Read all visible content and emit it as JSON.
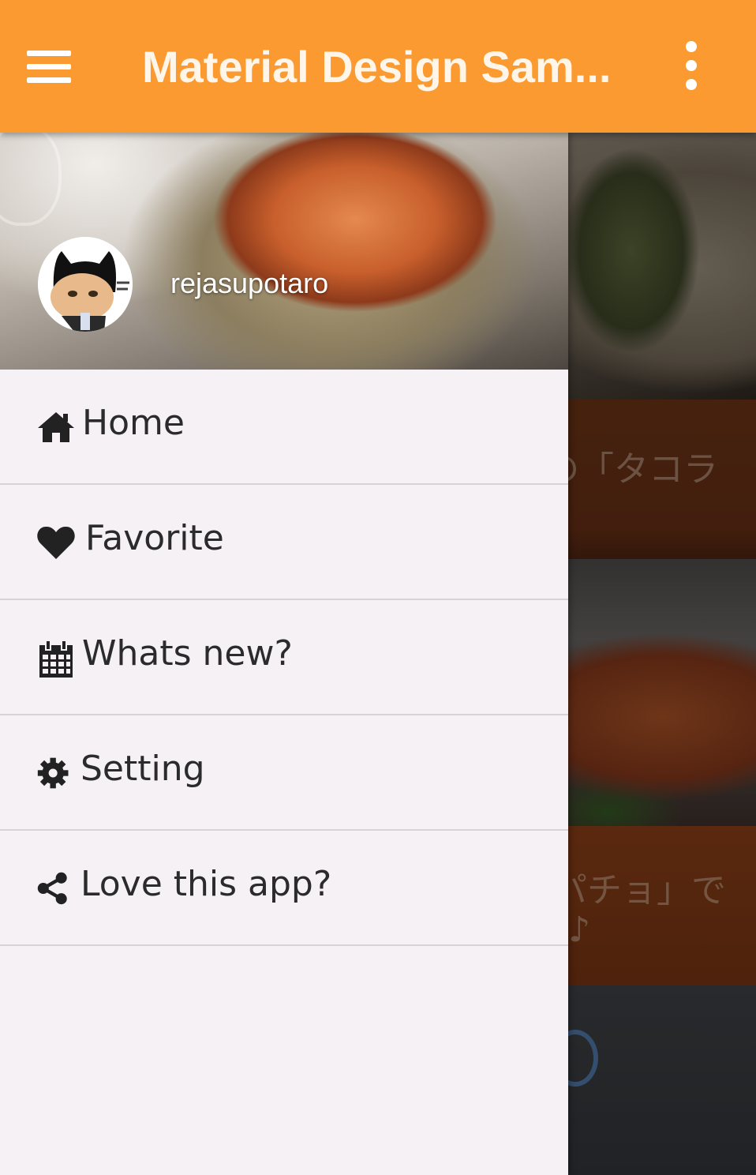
{
  "toolbar": {
    "title": "Material Design Sam...",
    "background_color": "#fb9a30",
    "menu_icon": "hamburger-menu-icon",
    "overflow_icon": "more-vertical-icon"
  },
  "drawer": {
    "header": {
      "username": "rejasupotaro"
    },
    "items": [
      {
        "label": "Home",
        "icon": "home-icon"
      },
      {
        "label": "Favorite",
        "icon": "heart-icon"
      },
      {
        "label": "Whats new?",
        "icon": "calendar-icon"
      },
      {
        "label": "Setting",
        "icon": "gear-icon"
      },
      {
        "label": "Love this app?",
        "icon": "share-icon"
      }
    ]
  },
  "background": {
    "cards": [
      {
        "caption": "の「タコラ"
      },
      {
        "caption_line1": "パチョ」で",
        "caption_line2": "♪"
      }
    ]
  }
}
